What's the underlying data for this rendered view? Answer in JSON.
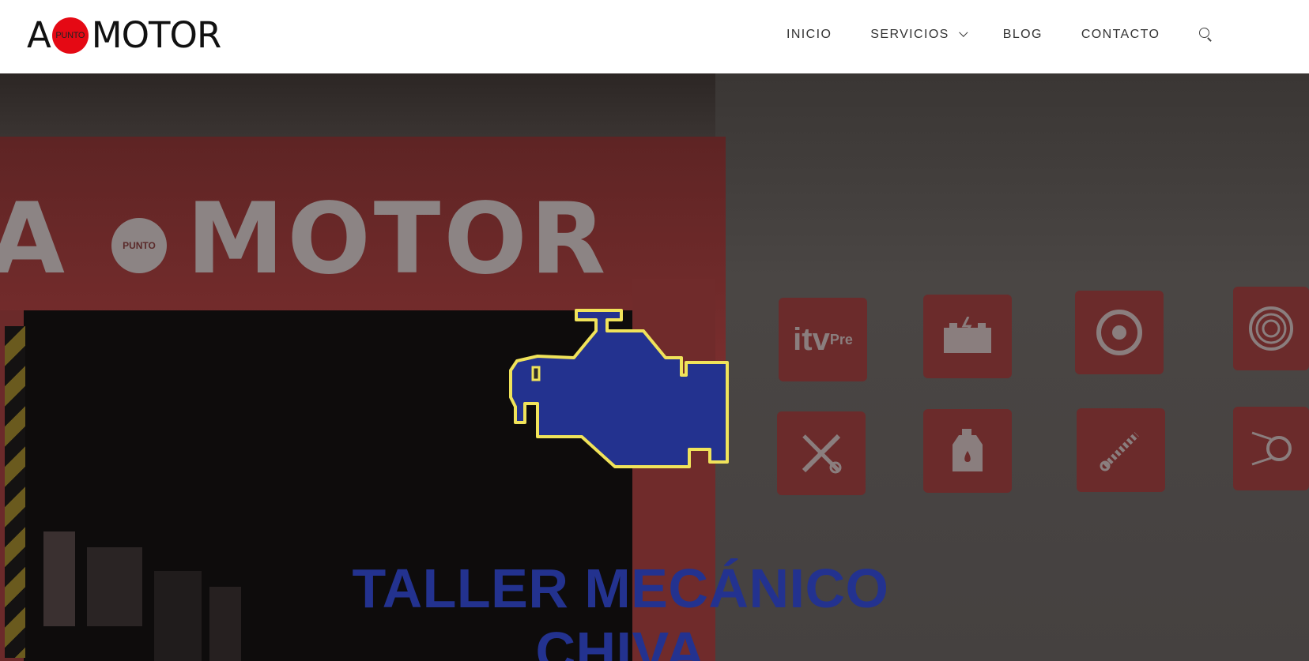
{
  "brand": {
    "letter_a": "A",
    "dot_text": "PUNTO",
    "word": "MOTOR",
    "dot_color": "#e50914"
  },
  "nav": {
    "items": [
      {
        "label": "INICIO"
      },
      {
        "label": "SERVICIOS",
        "has_dropdown": true
      },
      {
        "label": "BLOG"
      },
      {
        "label": "CONTACTO"
      }
    ],
    "search_icon": "search-icon"
  },
  "hero": {
    "sign_text_a": "A",
    "sign_text_motor": "MOTOR",
    "sign_dot_text": "PUNTO",
    "engine_icon": "engine-check-icon",
    "engine_fill": "#23328f",
    "engine_outline": "#f0e35a",
    "title_line1": "TALLER MECÁNICO",
    "title_line2": "CHIVA",
    "title_color": "#23328f",
    "service_icons": [
      "itv-pre-icon",
      "battery-icon",
      "brake-disc-icon",
      "tire-icon",
      "tools-icon",
      "oil-can-icon",
      "shock-absorber-icon",
      "timing-belt-icon"
    ],
    "service_icon_itv_text": "itv",
    "service_icon_pre_text": "Pre"
  }
}
